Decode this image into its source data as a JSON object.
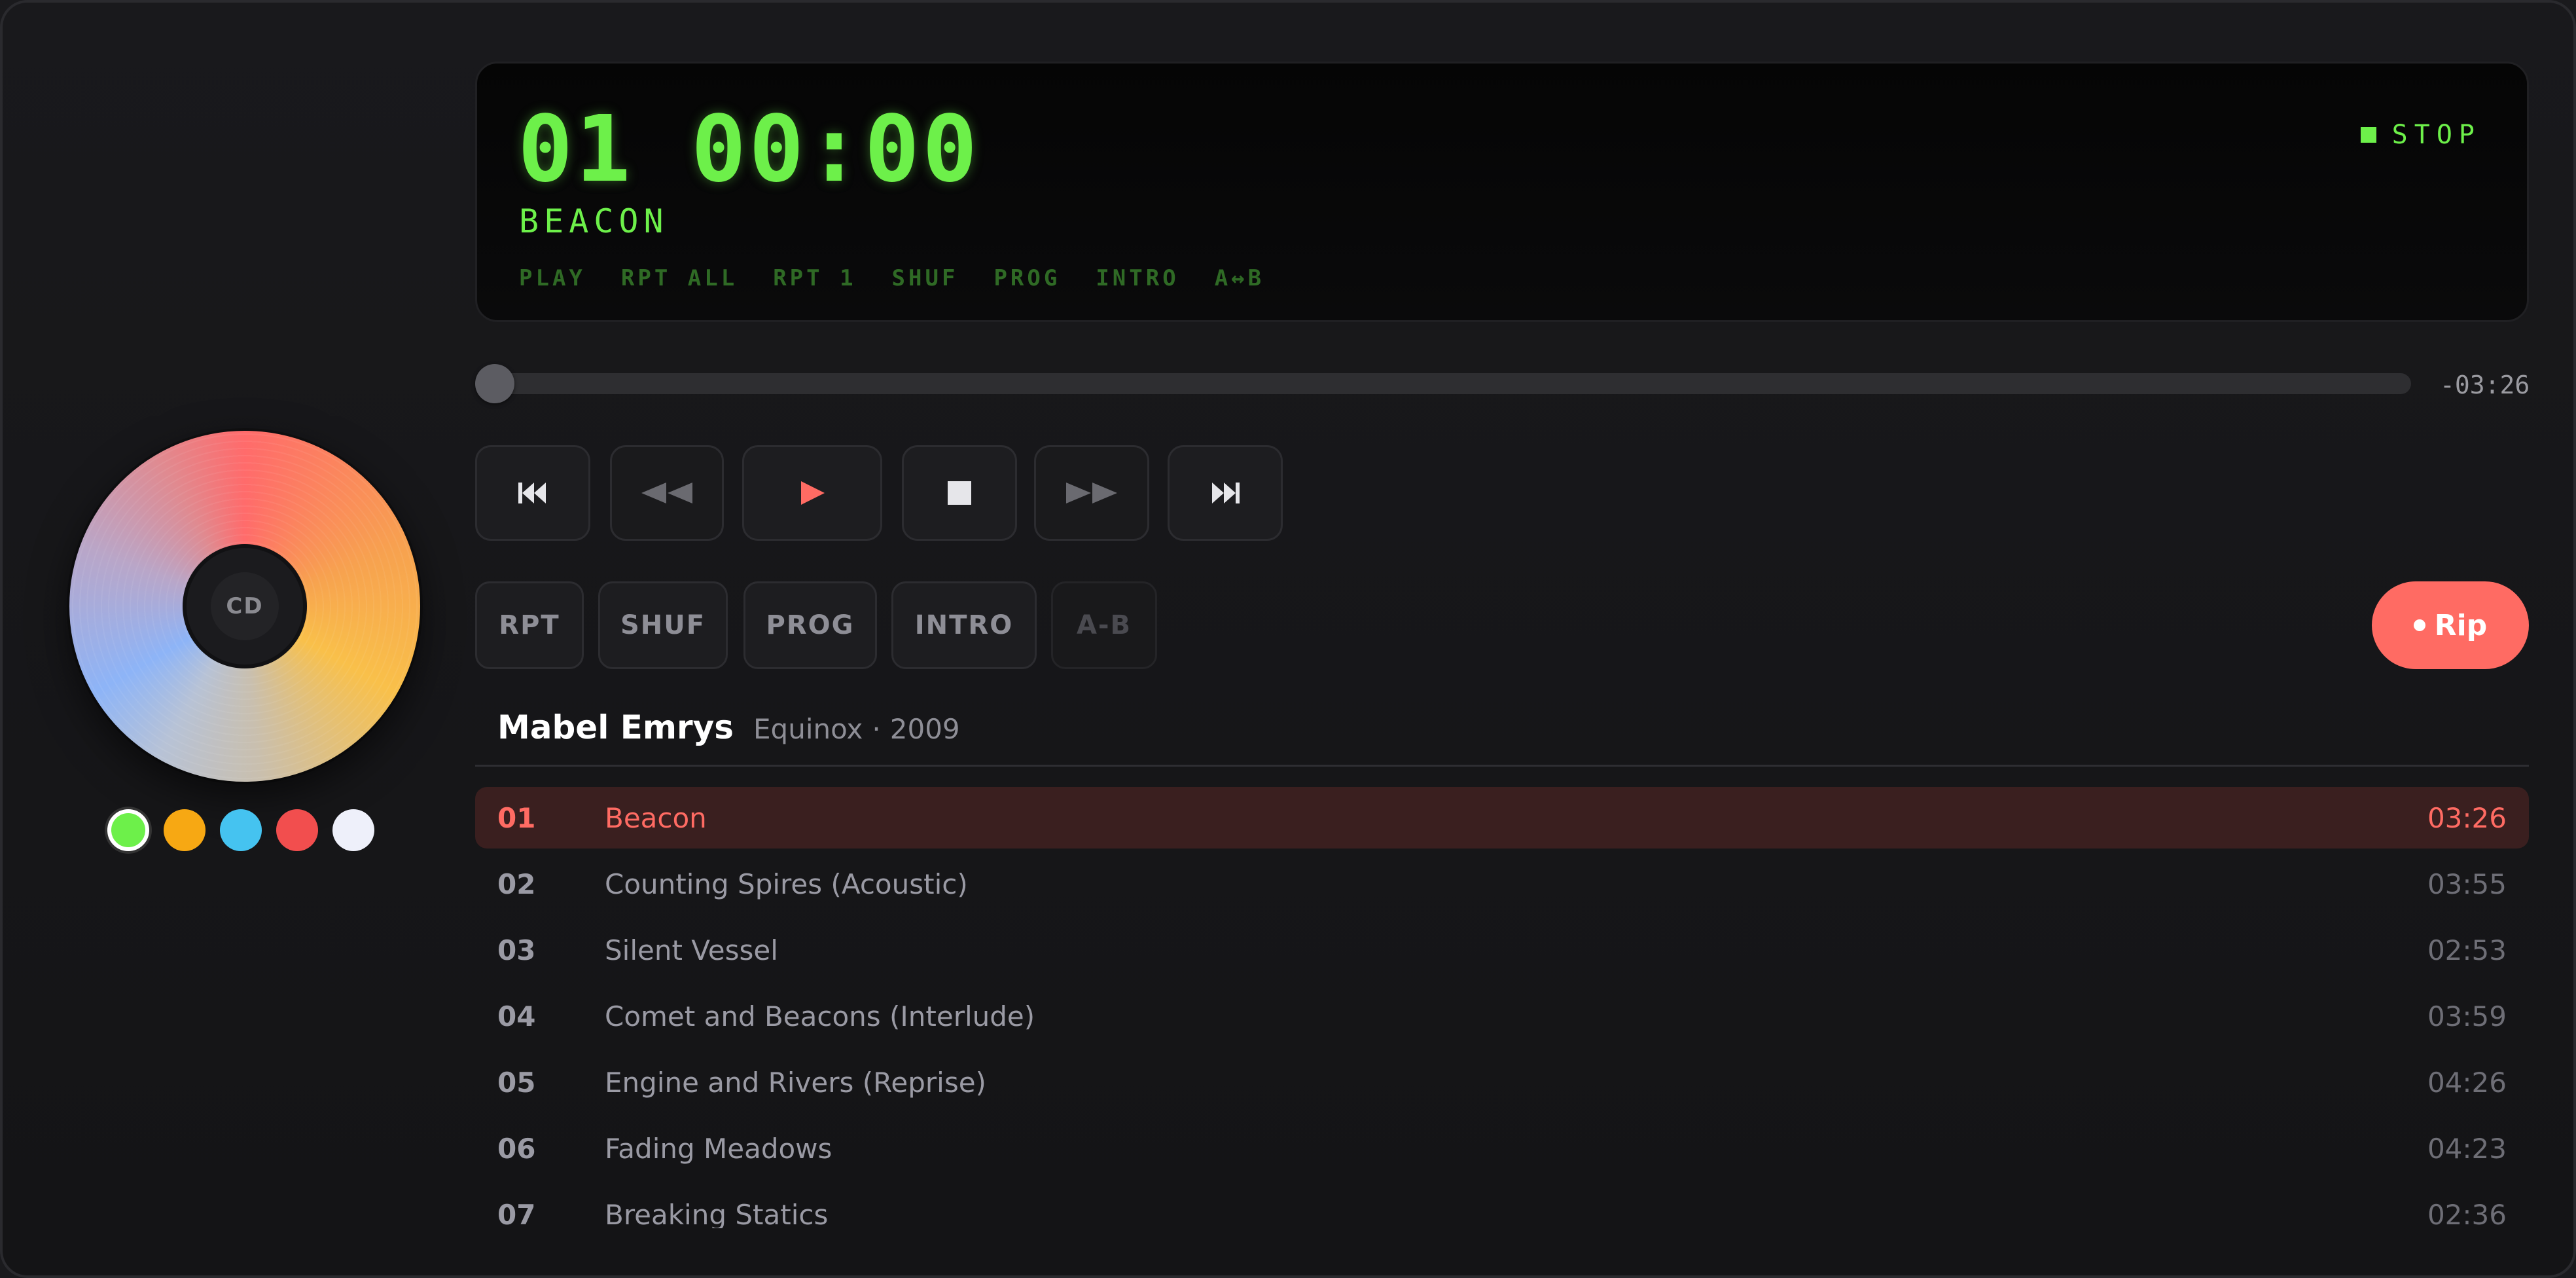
{
  "disc": {
    "hub_label": "CD"
  },
  "swatches": [
    {
      "name": "green",
      "color": "#6df04a",
      "selected": true
    },
    {
      "name": "orange",
      "color": "#f7a813",
      "selected": false
    },
    {
      "name": "blue",
      "color": "#45c3f0",
      "selected": false
    },
    {
      "name": "red",
      "color": "#f24e4e",
      "selected": false
    },
    {
      "name": "white",
      "color": "#eef0fa",
      "selected": false
    }
  ],
  "lcd": {
    "track_number": "01",
    "time": "00:00",
    "track_title": "BEACON",
    "status": "STOP",
    "modes": [
      "PLAY",
      "RPT ALL",
      "RPT 1",
      "SHUF",
      "PROG",
      "INTRO",
      "A↔B"
    ]
  },
  "progress": {
    "fraction": 0,
    "remaining": "-03:26"
  },
  "transport": {
    "prev_track": "previous-track",
    "rewind": "rewind",
    "play": "play",
    "stop": "stop",
    "fast_forward": "fast-forward",
    "next_track": "next-track"
  },
  "modes": {
    "rpt": "RPT",
    "shuf": "SHUF",
    "prog": "PROG",
    "intro": "INTRO",
    "ab": "A-B"
  },
  "rip_label": "Rip",
  "album": {
    "artist": "Mabel Emrys",
    "title": "Equinox",
    "year": "2009"
  },
  "tracks": [
    {
      "num": "01",
      "title": "Beacon",
      "duration": "03:26",
      "active": true
    },
    {
      "num": "02",
      "title": "Counting Spires (Acoustic)",
      "duration": "03:55",
      "active": false
    },
    {
      "num": "03",
      "title": "Silent Vessel",
      "duration": "02:53",
      "active": false
    },
    {
      "num": "04",
      "title": "Comet and Beacons (Interlude)",
      "duration": "03:59",
      "active": false
    },
    {
      "num": "05",
      "title": "Engine and Rivers (Reprise)",
      "duration": "04:26",
      "active": false
    },
    {
      "num": "06",
      "title": "Fading Meadows",
      "duration": "04:23",
      "active": false
    },
    {
      "num": "07",
      "title": "Breaking Statics",
      "duration": "02:36",
      "active": false
    }
  ],
  "colors": {
    "accent": "#ff6b63",
    "lcd_green": "#6df04a",
    "lcd_dim": "#2f6a25"
  }
}
